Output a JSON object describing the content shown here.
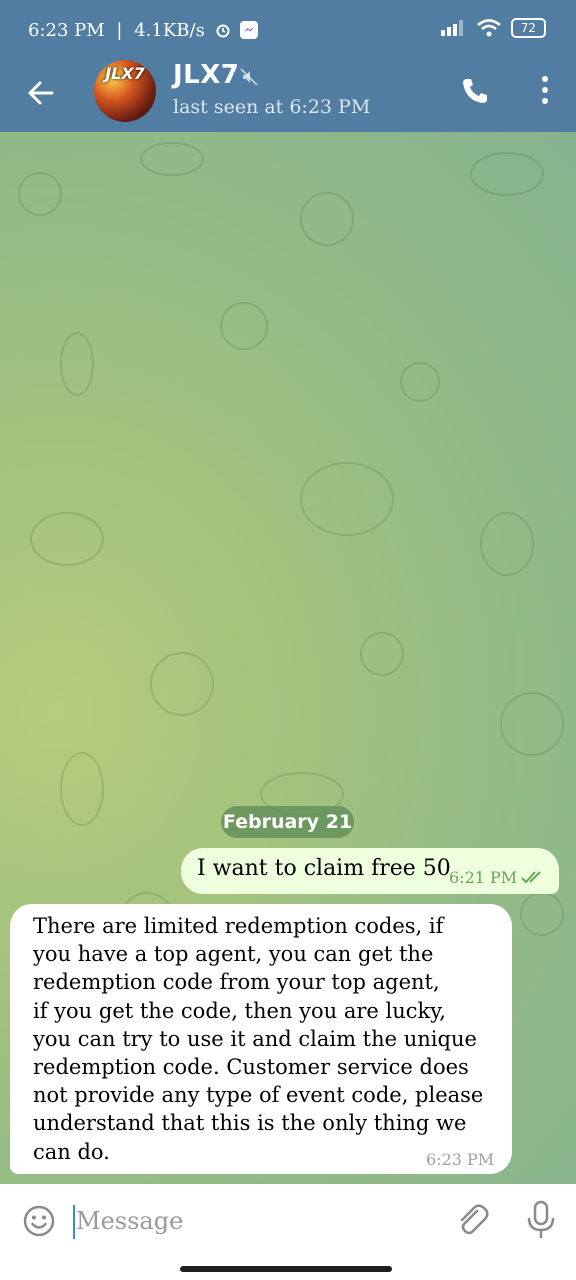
{
  "status_bar": {
    "time": "6:23 PM",
    "separator": "|",
    "speed": "4.1KB/s",
    "icons": [
      "alarm-icon",
      "messenger-icon",
      "signal-icon",
      "wifi-icon",
      "battery-icon"
    ],
    "battery": "72"
  },
  "header": {
    "avatar_text": "JLX7",
    "title": "JLX7",
    "subtitle": "last seen at 6:23 PM",
    "icons": [
      "back-arrow-icon",
      "muted-icon",
      "phone-icon",
      "more-vertical-icon"
    ]
  },
  "chat": {
    "date": "February 21",
    "messages": [
      {
        "direction": "outgoing",
        "text": "I want to claim free 50",
        "time": "6:21 PM",
        "status": "read"
      },
      {
        "direction": "incoming",
        "text": "There are limited redemption codes, if\nyou have a top agent, you can get the\nredemption code from your top agent,\nif you get the code, then you are lucky,\nyou can try to use it and claim the unique\nredemption code. Customer service does\nnot provide any type of event code, please\nunderstand that this is the only thing we\ncan do.",
        "time": "6:23 PM"
      }
    ]
  },
  "composer": {
    "placeholder": "Message",
    "value": "",
    "icons": [
      "emoji-icon",
      "attach-icon",
      "mic-icon"
    ]
  },
  "colors": {
    "header": "#517da2",
    "outgoing_bubble": "#eeffde",
    "incoming_bubble": "#ffffff",
    "read_ticks": "#6aa55a",
    "date_pill": "#64915a"
  }
}
